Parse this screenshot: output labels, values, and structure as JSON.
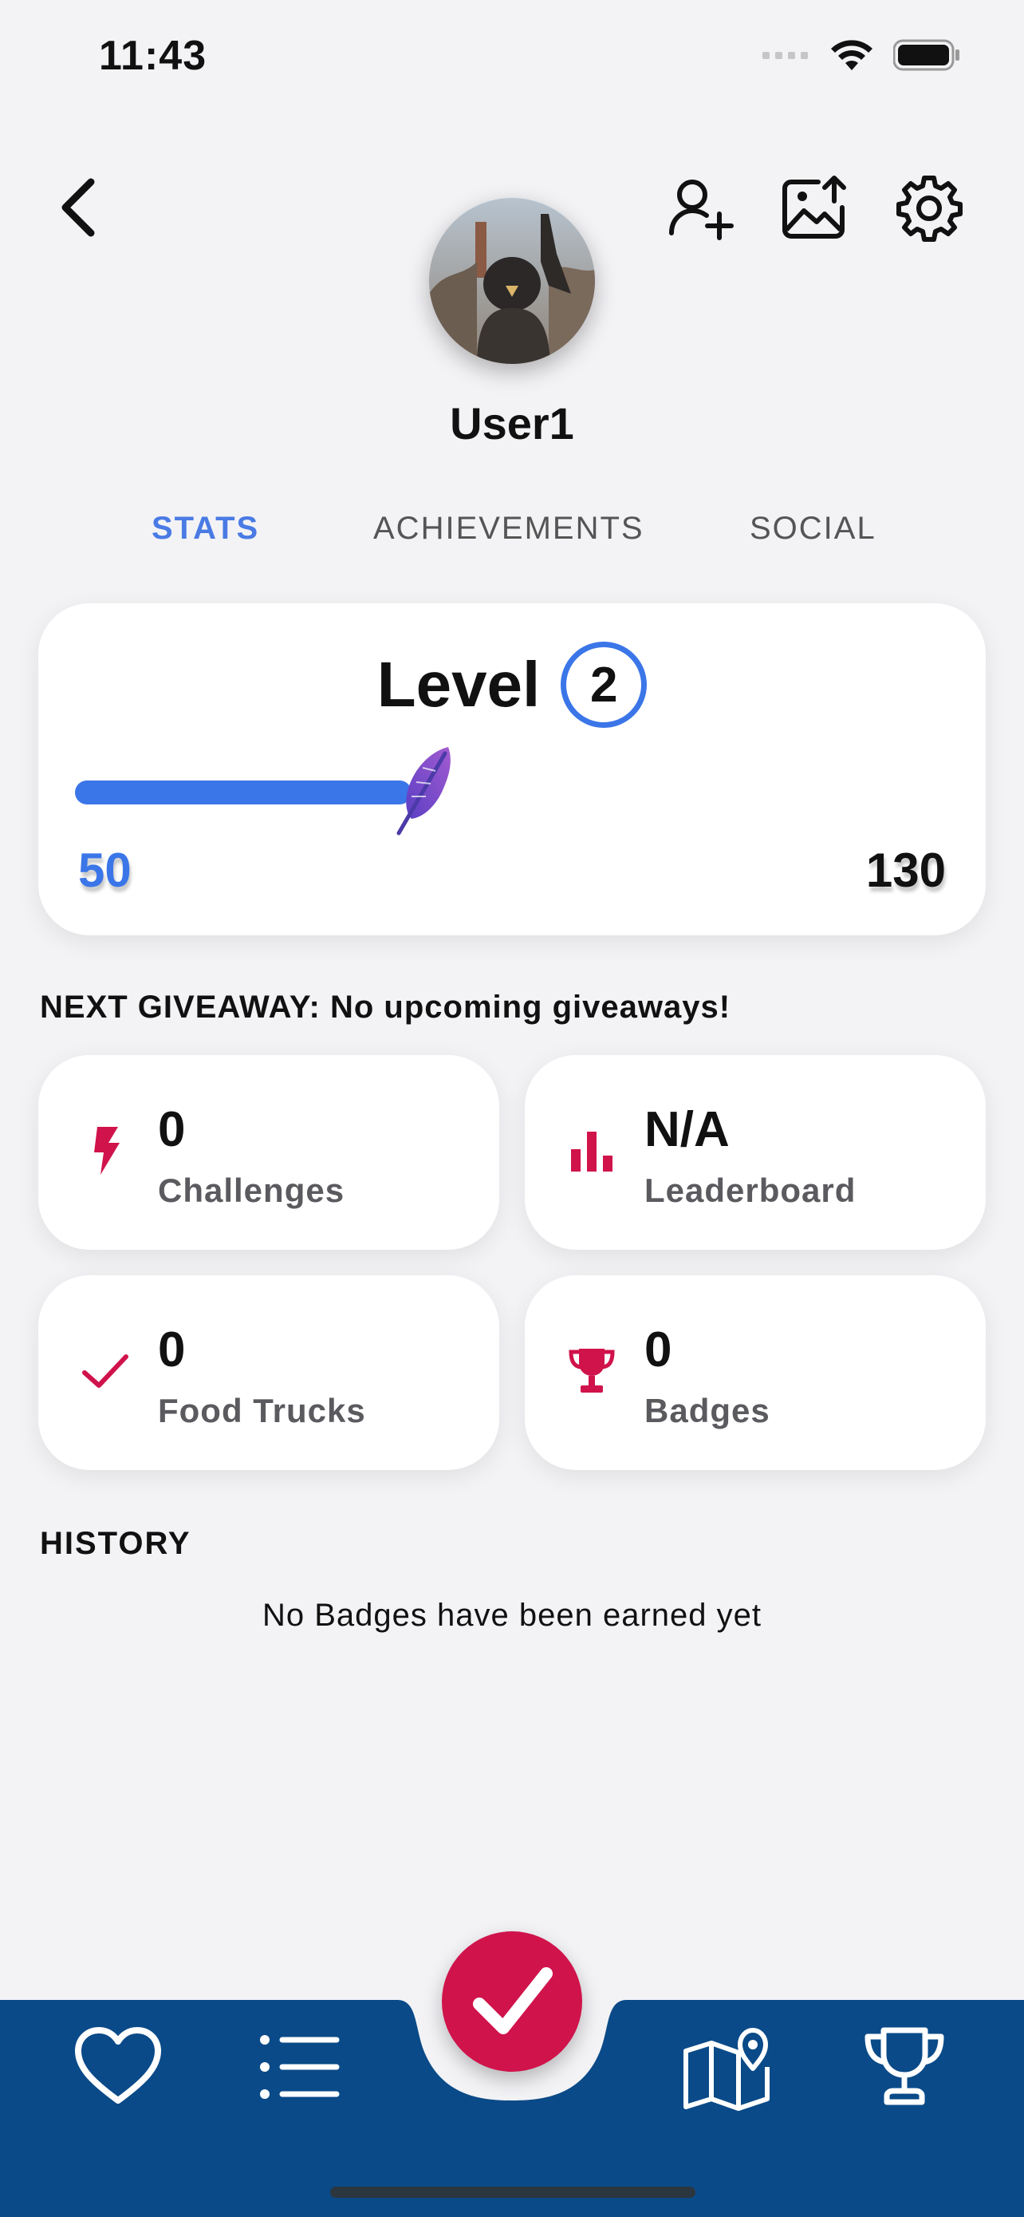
{
  "status_bar": {
    "time": "11:43"
  },
  "header": {
    "back_icon": "chevron-left-icon",
    "actions": [
      "add-friend-icon",
      "upload-image-icon",
      "gear-icon"
    ],
    "username": "User1"
  },
  "tabs": [
    {
      "label": "STATS",
      "active": true
    },
    {
      "label": "ACHIEVEMENTS",
      "active": false
    },
    {
      "label": "SOCIAL",
      "active": false
    }
  ],
  "level": {
    "label": "Level",
    "number": "2",
    "current": "50",
    "max": "130",
    "progress_fraction": 0.385,
    "accent": "#3b76e8"
  },
  "giveaway_text": "NEXT GIVEAWAY: No upcoming giveaways!",
  "stats": [
    {
      "value": "0",
      "label": "Challenges",
      "icon": "lightning-icon"
    },
    {
      "value": "N/A",
      "label": "Leaderboard",
      "icon": "bar-chart-icon"
    },
    {
      "value": "0",
      "label": "Food Trucks",
      "icon": "checkmark-icon"
    },
    {
      "value": "0",
      "label": "Badges",
      "icon": "trophy-icon"
    }
  ],
  "history": {
    "title": "HISTORY",
    "empty_message": "No Badges have been earned yet"
  },
  "bottom_nav": {
    "items": [
      "heart-icon",
      "list-icon",
      "check-in-button",
      "map-icon",
      "trophy-icon"
    ],
    "bar_color": "#0a4a88",
    "center_color": "#d0134b"
  },
  "colors": {
    "brand_red": "#d0134b",
    "accent_blue": "#3b76e8",
    "background": "#f3f3f6"
  }
}
